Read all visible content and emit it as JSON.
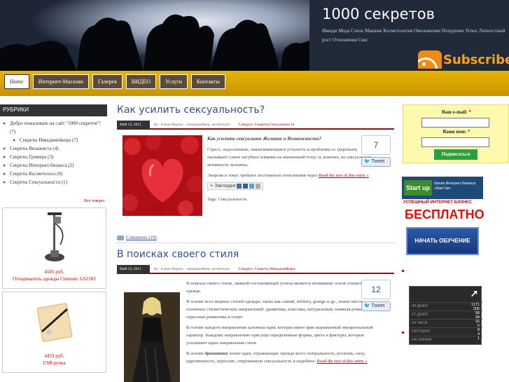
{
  "site": {
    "title": "1000 секретов",
    "description": "Имидж Мода Стиль Макияж Косметология Омоложение Похудение Успех Личностный рост Отношения Секс",
    "subscribe_label": "Subscribe"
  },
  "nav": {
    "items": [
      "Home",
      "Интернет-Магазин",
      "Галерея",
      "ВИДЕО",
      "Услуги",
      "Контакты"
    ]
  },
  "sidebar": {
    "heading": "РУБРИКИ",
    "categories": [
      "Добро пожаловать на сайт \"1000 секретов\"! (7)",
      "Секреты Имиджмейкера (7)",
      "Секреты Визажиста (4)",
      "Секреты Гримера (3)",
      "Секреты Интернет-бизнеса (2)",
      "Секреты Косметолога (6)",
      "Секреты Сексуальности (1)"
    ],
    "all_goods": "Все товары",
    "products": [
      {
        "price": "4505 руб.",
        "name": "Отпариватель одежды Clatronic GS2183"
      },
      {
        "price": "4433 руб.",
        "name": "USB ручка"
      }
    ]
  },
  "posts": [
    {
      "title": "Как усилить сексуальность?",
      "date": "Май 13, 2011",
      "by": "By: Алена Фортес - имиджмейкер, косметолог",
      "category": "Category: Секреты Сексуальности",
      "lead": "Как усилить сексуальное Желание и Возможности?",
      "p1": "Стресс, недосыпание, накапливающаяся усталость и проблемы со здоровьем, оказывают самое пагубное влияние на жизненный тонус и, конечно, на сексуальную активность человека.",
      "p2": "Энергия и тонус требуют постоянного пополнения через",
      "read_more": "Read the rest of this entry »",
      "bookmark_label": "Закладки",
      "tags": "Tags: Сексуальность",
      "comments": "Comments (19)",
      "share_count": "7",
      "tweet_label": "Tweet"
    },
    {
      "title": "В поисках своего стиля",
      "date": "Май 12, 2011",
      "by": "By: Алена Фортес - имиджмейкер, косметолог",
      "category": "Category: Секреты Имиджмейкера",
      "p1": "В поисках своего стиля , важной составляющей успеха является понимание основ стилистики в одежде.",
      "p2": "В основе всех модных стилей одежды, таких как самый, military, grunge и др., лежит шесть основных стилистических направлений: драматика, классика, натуральный, наивная романтика, серьезная романтика и спорт.",
      "p3": "В основе каждого направления заложена идея, которая имеет ярко выраженный эмоциональный характер. Каждому направлению присущи определенные формы, цвета и фактуры, которые усиливают идею направления стиля.",
      "p4a": "В основе",
      "p4b": "драматики",
      "p4c": "лежит идея, отражающая, прежде всего театральность, роскошь, силу, царственность, агрессию, откровенную сексуальность и подобное.",
      "read_more": "Read the rest of this entry »",
      "share_count": "12",
      "tweet_label": "Tweet"
    }
  ],
  "subscribe_form": {
    "email_label": "Ваш e-mail:",
    "name_label": "Ваше имя:",
    "required_mark": "*",
    "submit_label": "Подписаться"
  },
  "banner": {
    "logo": "Start up",
    "subtitle": "Школа Интернет-Бизнеса «Start Up»",
    "red_line": "УСПЕШНЫЙ ИНТЕРНЕТ-БИЗНЕС",
    "free": "БЕСПЛАТНО",
    "button": "НАЧАТЬ ОБУЧЕНИЕ"
  },
  "counter": {
    "rows": [
      {
        "label": "30 ДНЕЙ",
        "value": "1171\n200"
      },
      {
        "label": "07 ДНЕЙ",
        "value": "58\n34"
      },
      {
        "label": "24 ЧАСА",
        "value": "16\n5"
      },
      {
        "label": "СЕГОДНЯ",
        "value": "8\n4"
      },
      {
        "label": "НА ЛИНИИ",
        "value": "1"
      }
    ]
  },
  "colors": {
    "nav_gold": "#e8b300",
    "post_title": "#334f8a",
    "accent_red": "#8a1010",
    "subscribe_orange": "#f7a31c"
  }
}
